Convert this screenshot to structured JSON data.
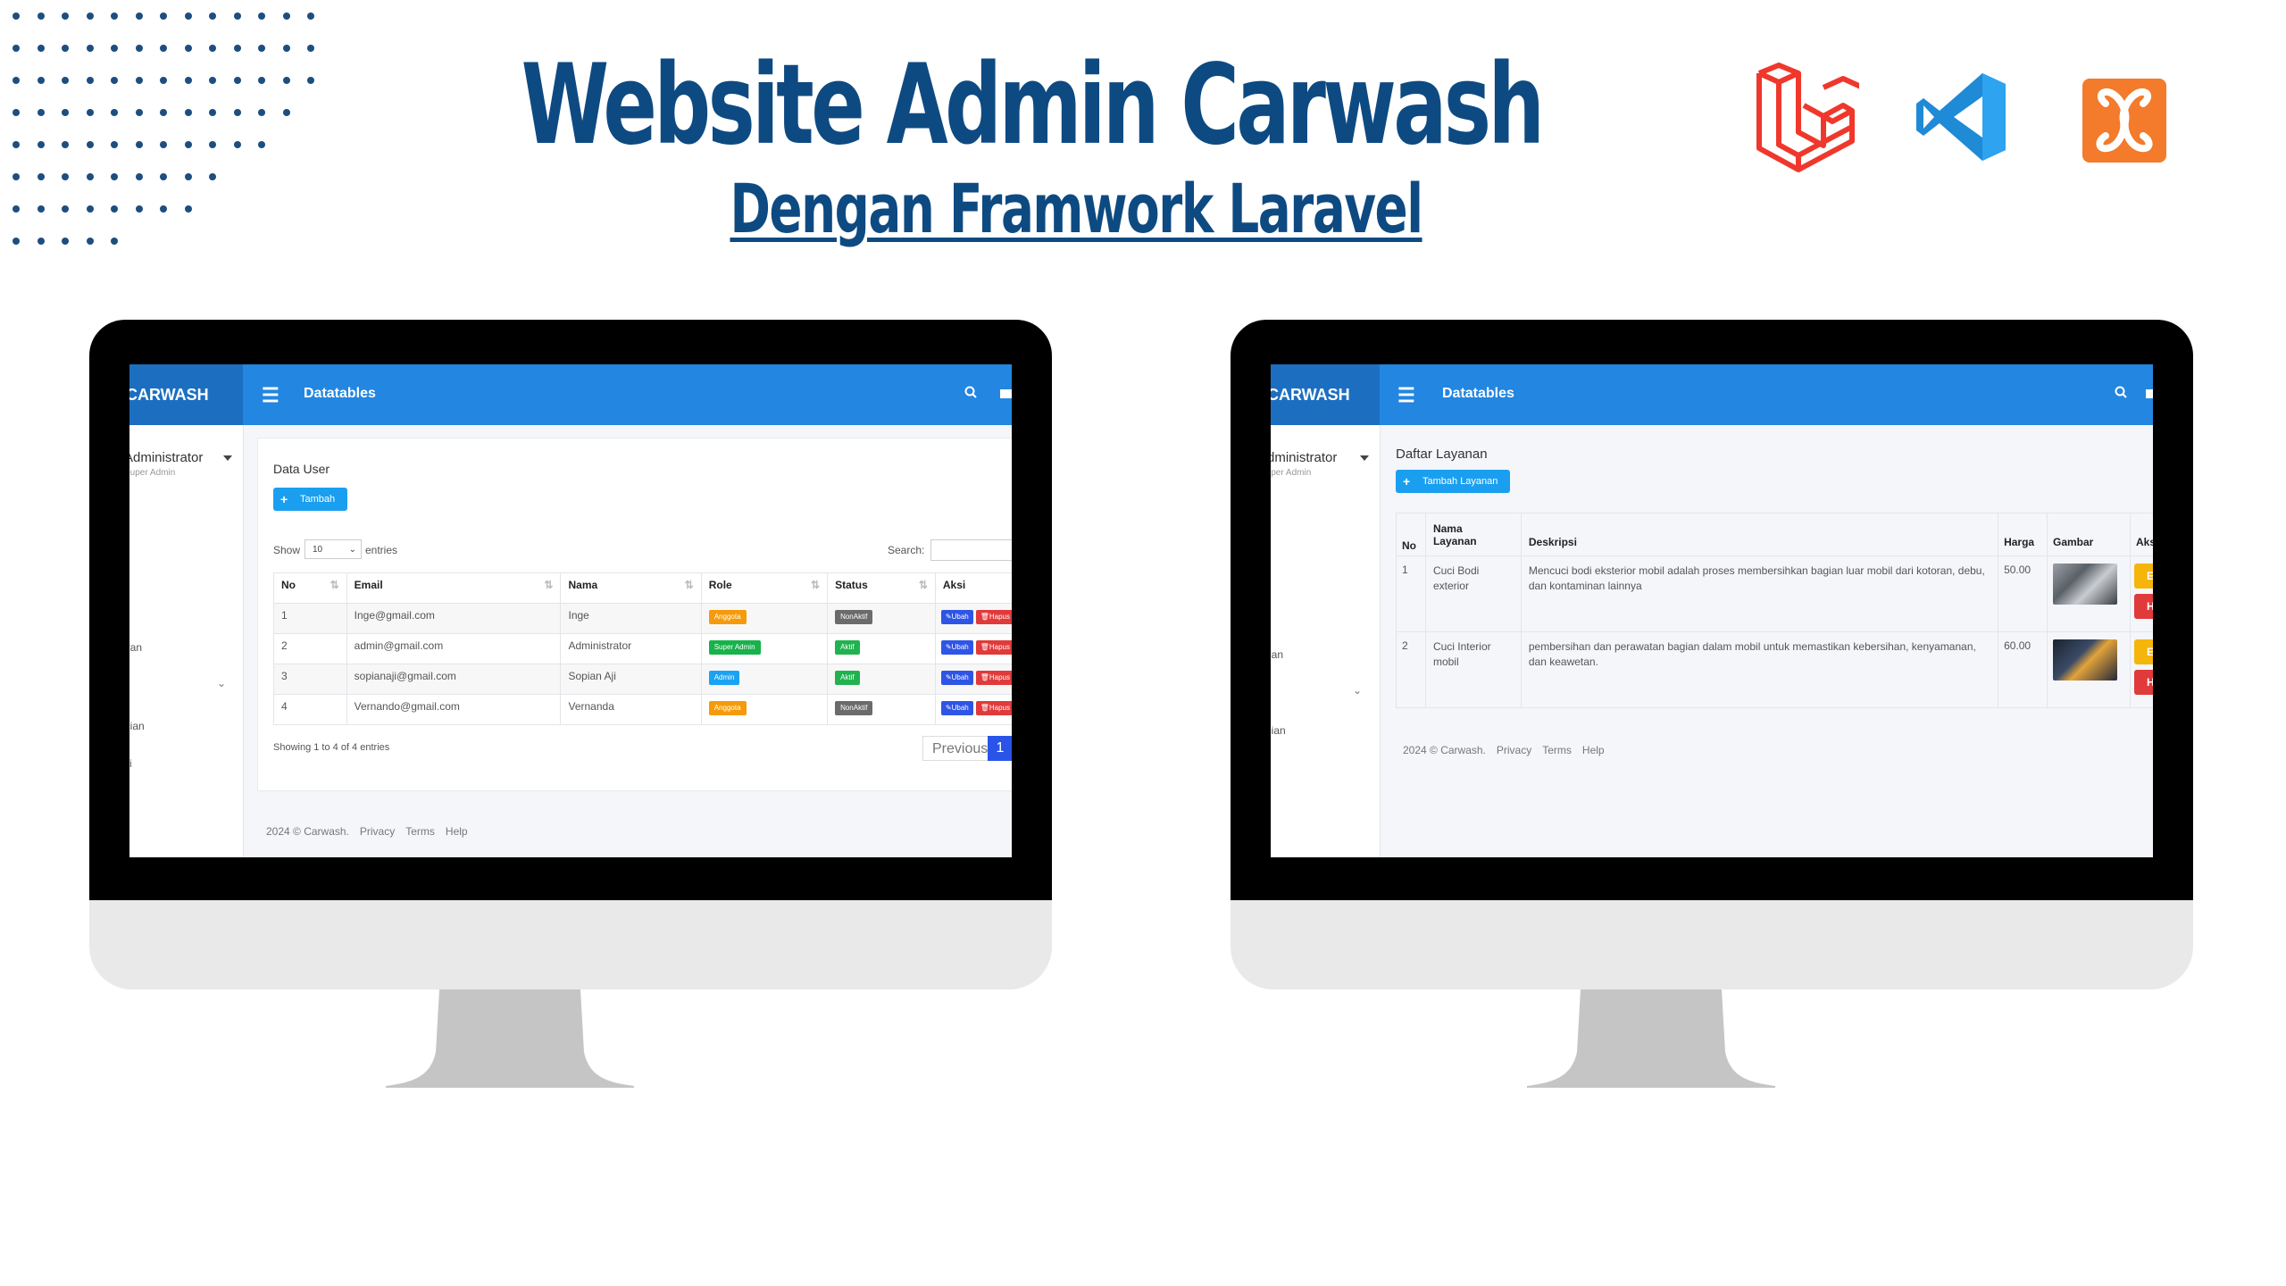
{
  "header": {
    "title": "Website Admin Carwash",
    "subtitle": "Dengan Framwork Laravel",
    "logos": [
      "laravel-logo",
      "vscode-logo",
      "xampp-logo"
    ]
  },
  "colors": {
    "title": "#0e4a82",
    "topbar": "#2386e0",
    "brand": "#1c6fc0",
    "anggota": "#f59b0b",
    "super_admin": "#17b24a",
    "admin": "#1aa3f2",
    "aktif": "#21b24f",
    "nonaktif": "#6b6b6b",
    "ubah": "#2f55e6",
    "hapus": "#e03a3a",
    "edit": "#f5b50a"
  },
  "screen1": {
    "brand": "CARWASH",
    "page_title": "Datatables",
    "sidebar": {
      "user": "Administrator",
      "role": "Super Admin",
      "items": [
        "n",
        "aran",
        "ncian",
        "si"
      ]
    },
    "card_title": "Data User",
    "add_button": "Tambah",
    "show_label": "Show",
    "entries_value": "10",
    "entries_label": "entries",
    "search_label": "Search:",
    "columns": [
      "No",
      "Email",
      "Nama",
      "Role",
      "Status",
      "Aksi"
    ],
    "rows": [
      {
        "no": "1",
        "email": "Inge@gmail.com",
        "nama": "Inge",
        "role": "Anggota",
        "status": "NonAktif"
      },
      {
        "no": "2",
        "email": "admin@gmail.com",
        "nama": "Administrator",
        "role": "Super Admin",
        "status": "Aktif"
      },
      {
        "no": "3",
        "email": "sopianaji@gmail.com",
        "nama": "Sopian Aji",
        "role": "Admin",
        "status": "Aktif"
      },
      {
        "no": "4",
        "email": "Vernando@gmail.com",
        "nama": "Vernanda",
        "role": "Anggota",
        "status": "NonAktif"
      }
    ],
    "action_ubah": "Ubah",
    "action_hapus": "Hapus",
    "info": "Showing 1 to 4 of 4 entries",
    "pager_prev": "Previous",
    "pager_page": "1",
    "footer": {
      "copyright": "2024 © Carwash.",
      "links": [
        "Privacy",
        "Terms",
        "Help"
      ]
    }
  },
  "screen2": {
    "brand": "CARWASH",
    "page_title": "Datatables",
    "sidebar": {
      "user": "Administrator",
      "role": "Super Admin",
      "items": [
        "n",
        "aran",
        "ncian"
      ]
    },
    "card_title": "Daftar Layanan",
    "add_button": "Tambah Layanan",
    "columns": [
      "No",
      "Nama Layanan",
      "Deskripsi",
      "Harga",
      "Gambar",
      "Aksi"
    ],
    "rows": [
      {
        "no": "1",
        "nama": "Cuci Bodi exterior",
        "deskripsi": "Mencuci bodi eksterior mobil adalah proses membersihkan bagian luar mobil dari kotoran, debu, dan kontaminan lainnya",
        "harga": "50.00",
        "gambar": "exterior-wash-photo"
      },
      {
        "no": "2",
        "nama": "Cuci Interior mobil",
        "deskripsi": "pembersihan dan perawatan bagian dalam mobil untuk memastikan kebersihan, kenyamanan, dan keawetan.",
        "harga": "60.00",
        "gambar": "interior-cleaning-photo"
      }
    ],
    "action_edit": "Edit",
    "action_hapus": "Hapus",
    "footer": {
      "copyright": "2024 © Carwash.",
      "links": [
        "Privacy",
        "Terms",
        "Help"
      ]
    }
  }
}
